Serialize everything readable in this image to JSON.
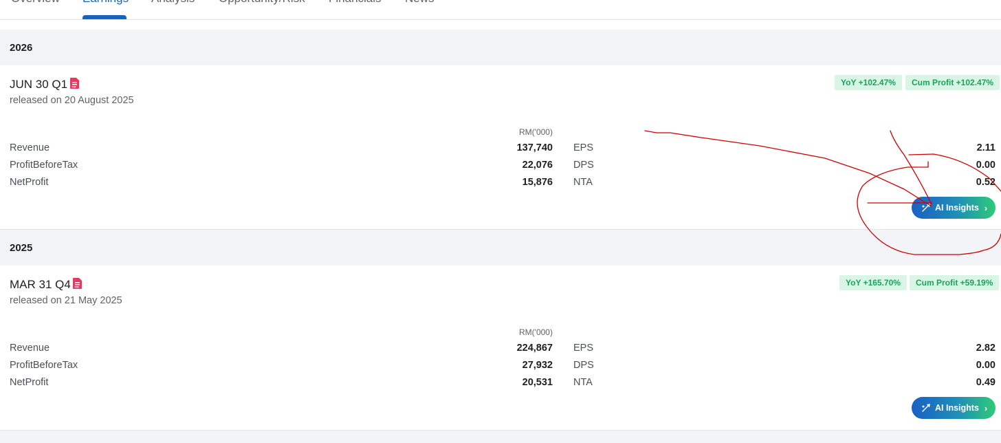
{
  "tabs": [
    "Overview",
    "Earnings",
    "Analysis",
    "Opportunity/Risk",
    "Financials",
    "News"
  ],
  "active_tab": "Earnings",
  "unit_label": "RM('000)",
  "ai_button_label": "AI Insights",
  "years": [
    {
      "year": "2026",
      "quarter": "JUN 30 Q1",
      "released": "released on 20 August 2025",
      "yoy": "YoY +102.47%",
      "cum_profit": "Cum Profit +102.47%",
      "revenue_label": "Revenue",
      "revenue": "137,740",
      "pbt_label": "ProfitBeforeTax",
      "pbt": "22,076",
      "np_label": "NetProfit",
      "np": "15,876",
      "eps_label": "EPS",
      "eps": "2.11",
      "dps_label": "DPS",
      "dps": "0.00",
      "nta_label": "NTA",
      "nta": "0.52"
    },
    {
      "year": "2025",
      "quarter": "MAR 31 Q4",
      "released": "released on 21 May 2025",
      "yoy": "YoY +165.70%",
      "cum_profit": "Cum Profit +59.19%",
      "revenue_label": "Revenue",
      "revenue": "224,867",
      "pbt_label": "ProfitBeforeTax",
      "pbt": "27,932",
      "np_label": "NetProfit",
      "np": "20,531",
      "eps_label": "EPS",
      "eps": "2.82",
      "dps_label": "DPS",
      "dps": "0.00",
      "nta_label": "NTA",
      "nta": "0.49"
    }
  ],
  "colors": {
    "accent": "#1565c0",
    "badge_bg": "#d8f5e6",
    "badge_text": "#1aa35a",
    "pdf_icon": "#e53961",
    "annotation": "#d40000"
  },
  "icons": {
    "report": "pdf-icon",
    "ai": "sparkle-icon",
    "chevron": "chevron-right-icon"
  }
}
